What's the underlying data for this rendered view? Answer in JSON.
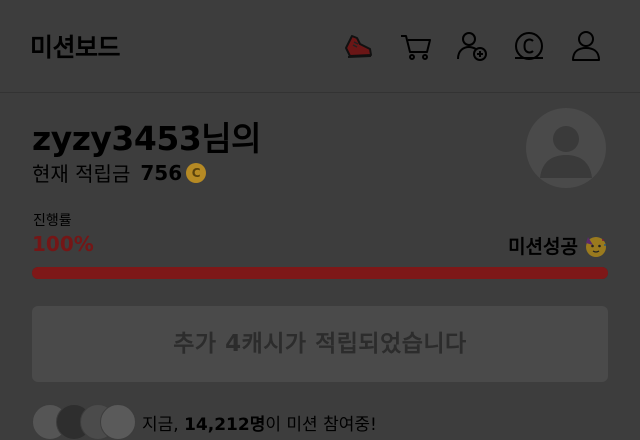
{
  "header": {
    "title": "미션보드",
    "icons": [
      "sneaker-icon",
      "cart-icon",
      "add-friend-icon",
      "cash-icon",
      "user-icon"
    ]
  },
  "profile": {
    "username": "zyzy3453님의",
    "points_label": "현재 적립금",
    "points_value": "756",
    "coin_symbol": "C"
  },
  "progress": {
    "label": "진행률",
    "value_text": "100%",
    "fraction": 1.0,
    "status": "미션성공"
  },
  "reward": {
    "message": "추가 4캐시가 적립되었습니다"
  },
  "participants": {
    "prefix": "지금,",
    "count": "14,212명",
    "suffix": "이 미션 참여중!"
  },
  "colors": {
    "accent": "#7e1818",
    "dim_overlay": "#3d3d3d"
  }
}
